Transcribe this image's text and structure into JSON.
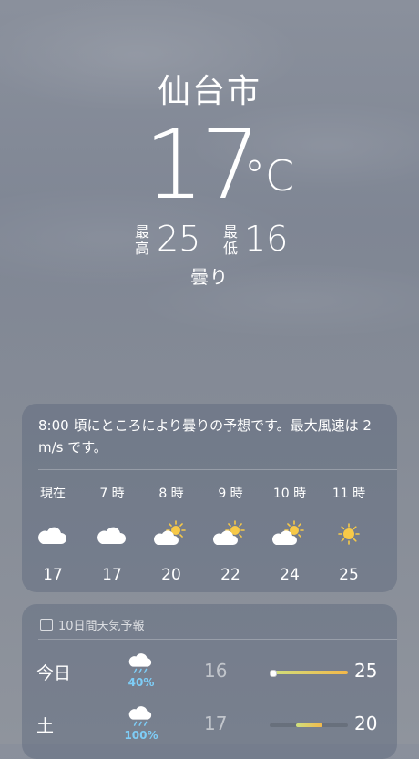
{
  "location": {
    "city": "仙台市",
    "temperature": "17",
    "unit": "°C",
    "high_label": "最高",
    "high": "25",
    "low_label": "最低",
    "low": "16",
    "condition": "曇り"
  },
  "hourly": {
    "summary": "8:00 頃にところにより曇りの予想です。最大風速は 2 m/s です。",
    "hours": [
      {
        "time": "現在",
        "icon": "cloud-icon",
        "temp": "17"
      },
      {
        "time": "7 時",
        "icon": "cloud-icon",
        "temp": "17"
      },
      {
        "time": "8 時",
        "icon": "partly-sunny-icon",
        "temp": "20"
      },
      {
        "time": "9 時",
        "icon": "partly-sunny-icon",
        "temp": "22"
      },
      {
        "time": "10 時",
        "icon": "partly-sunny-icon",
        "temp": "24"
      },
      {
        "time": "11 時",
        "icon": "sun-icon",
        "temp": "25"
      }
    ]
  },
  "daily": {
    "title": "10日間天気予報",
    "days": [
      {
        "name": "今日",
        "icon": "rain-cloud-icon",
        "precip": "40%",
        "low": "16",
        "high": "25",
        "range_start": 0.0,
        "range_end": 1.0,
        "current_marker": 0.0
      },
      {
        "name": "土",
        "icon": "rain-cloud-icon",
        "precip": "100%",
        "low": "17",
        "high": "20",
        "range_start": 0.34,
        "range_end": 0.68
      }
    ]
  },
  "colors": {
    "card": "#58647a",
    "precip": "#7ecdf7",
    "sun": "#f7c948",
    "bar_start": "#cfe07e",
    "bar_end": "#f3b84a"
  }
}
